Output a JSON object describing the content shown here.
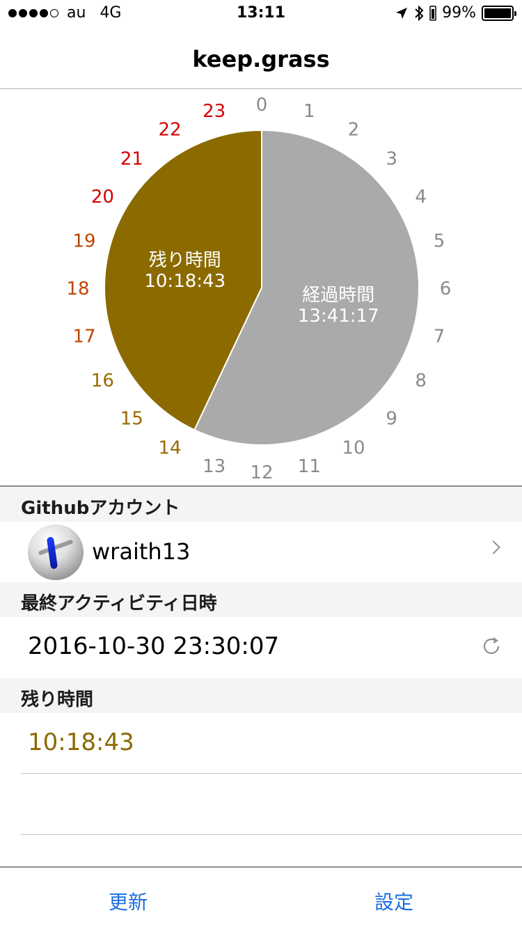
{
  "status_bar": {
    "carrier": "au",
    "network": "4G",
    "time": "13:11",
    "battery_percent": "99%",
    "battery_level": 0.99,
    "signal_bars_filled": 4,
    "signal_bars_total": 5
  },
  "nav": {
    "title": "keep.grass"
  },
  "chart_data": {
    "type": "pie",
    "hour_labels": [
      "0",
      "1",
      "2",
      "3",
      "4",
      "5",
      "6",
      "7",
      "8",
      "9",
      "10",
      "11",
      "12",
      "13",
      "14",
      "15",
      "16",
      "17",
      "18",
      "19",
      "20",
      "21",
      "22",
      "23"
    ],
    "segments": [
      {
        "label": "残り時間",
        "value": "10:18:43",
        "hours": 10.3119,
        "color": "#8b6b00"
      },
      {
        "label": "経過時間",
        "value": "13:41:17",
        "hours": 13.6881,
        "color": "#aaaaaa"
      }
    ],
    "colors": {
      "elapsed_label": "#8a8a8a",
      "remaining_late": "#d40000",
      "remaining_mid": "#c04500",
      "remaining_early": "#9a6a00"
    }
  },
  "account": {
    "header": "Githubアカウント",
    "username": "wraith13"
  },
  "activity": {
    "header": "最終アクティビティ日時",
    "datetime": "2016-10-30 23:30:07"
  },
  "remaining": {
    "header": "残り時間",
    "value": "10:18:43"
  },
  "tabs": {
    "update_label": "更新",
    "settings_label": "設定"
  },
  "accent_color": "#1a6fe0"
}
